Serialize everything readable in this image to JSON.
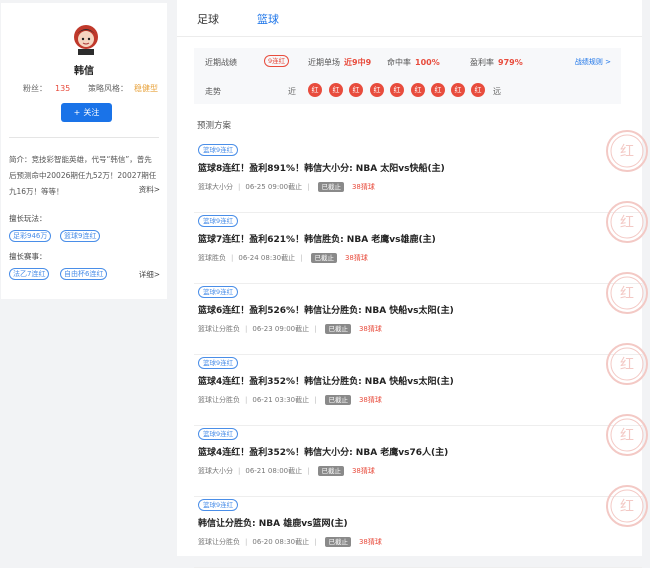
{
  "profile": {
    "name": "韩信",
    "fans_label": "粉丝：",
    "fans_value": "135",
    "strategy_label": "策略风格：",
    "strategy_value": "稳健型",
    "follow_label": "关注",
    "bio_lines": [
      "简介：竞技彩智能英雄，代号“韩信”，曾先",
      "后预测命中20026期任九52万！20027期任",
      "九16万！等等！"
    ],
    "bio_more": "资料>",
    "play_label": "擅长玩法：",
    "play_tags": [
      "足彩946万",
      "篮球9连红"
    ],
    "event_label": "擅长赛事：",
    "event_tags": [
      "法乙7连红",
      "自由杯6连红"
    ],
    "event_more": "详细>"
  },
  "tabs": [
    {
      "label": "足球",
      "active": false
    },
    {
      "label": "篮球",
      "active": true
    }
  ],
  "stats": {
    "recent_label": "近期战绩",
    "recent_badge": "9连红",
    "single_label": "近期单场",
    "single_value": "近9中9",
    "hit_label": "命中率",
    "hit_value": "100%",
    "profit_label": "盈利率",
    "profit_value": "979%",
    "rules_link": "战绩规则 >",
    "trend_label": "走势",
    "trend_near": "近",
    "trend_far": "远",
    "trend": [
      "红",
      "红",
      "红",
      "红",
      "红",
      "红",
      "红",
      "红",
      "红"
    ]
  },
  "section_title": "预测方案",
  "cards": [
    {
      "tag": "篮球9连红",
      "title": "篮球8连红！盈利891%！韩信大小分: NBA 太阳vs快船(主)",
      "type": "篮球大小分",
      "time": "06-25 09:00截止",
      "status": "已截止",
      "price": "38猜球"
    },
    {
      "tag": "篮球9连红",
      "title": "篮球7连红！盈利621%！韩信胜负: NBA 老鹰vs雄鹿(主)",
      "type": "篮球胜负",
      "time": "06-24 08:30截止",
      "status": "已截止",
      "price": "38猜球"
    },
    {
      "tag": "篮球9连红",
      "title": "篮球6连红！盈利526%！韩信让分胜负: NBA 快船vs太阳(主)",
      "type": "篮球让分胜负",
      "time": "06-23 09:00截止",
      "status": "已截止",
      "price": "38猜球"
    },
    {
      "tag": "篮球9连红",
      "title": "篮球4连红！盈利352%！韩信让分胜负: NBA 快船vs太阳(主)",
      "type": "篮球让分胜负",
      "time": "06-21 03:30截止",
      "status": "已截止",
      "price": "38猜球"
    },
    {
      "tag": "篮球9连红",
      "title": "篮球4连红！盈利352%！韩信大小分: NBA 老鹰vs76人(主)",
      "type": "篮球大小分",
      "time": "06-21 08:00截止",
      "status": "已截止",
      "price": "38猜球"
    },
    {
      "tag": "篮球9连红",
      "title": "韩信让分胜负: NBA 雄鹿vs篮网(主)",
      "type": "篮球让分胜负",
      "time": "06-20 08:30截止",
      "status": "已截止",
      "price": "38猜球"
    }
  ],
  "stamp_text": "红",
  "colors": {
    "accent": "#1a73e8",
    "red": "#e84c3d",
    "gold": "#e8a33d"
  }
}
